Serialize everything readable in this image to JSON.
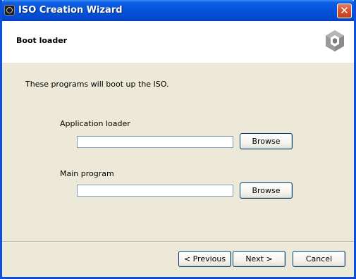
{
  "window": {
    "title": "ISO Creation Wizard",
    "close_label": "✕"
  },
  "header": {
    "title": "Boot loader",
    "logo_icon": "gamecube-logo-icon"
  },
  "main": {
    "description": "These programs will boot up the ISO.",
    "fields": [
      {
        "label": "Application loader",
        "value": "",
        "browse_label": "Browse"
      },
      {
        "label": "Main program",
        "value": "",
        "browse_label": "Browse"
      }
    ]
  },
  "footer": {
    "previous_label": "< Previous",
    "next_label": "Next >",
    "cancel_label": "Cancel"
  },
  "colors": {
    "titlebar": "#0553d9",
    "dialog_bg": "#ece9d8",
    "close_button": "#d5522f"
  }
}
